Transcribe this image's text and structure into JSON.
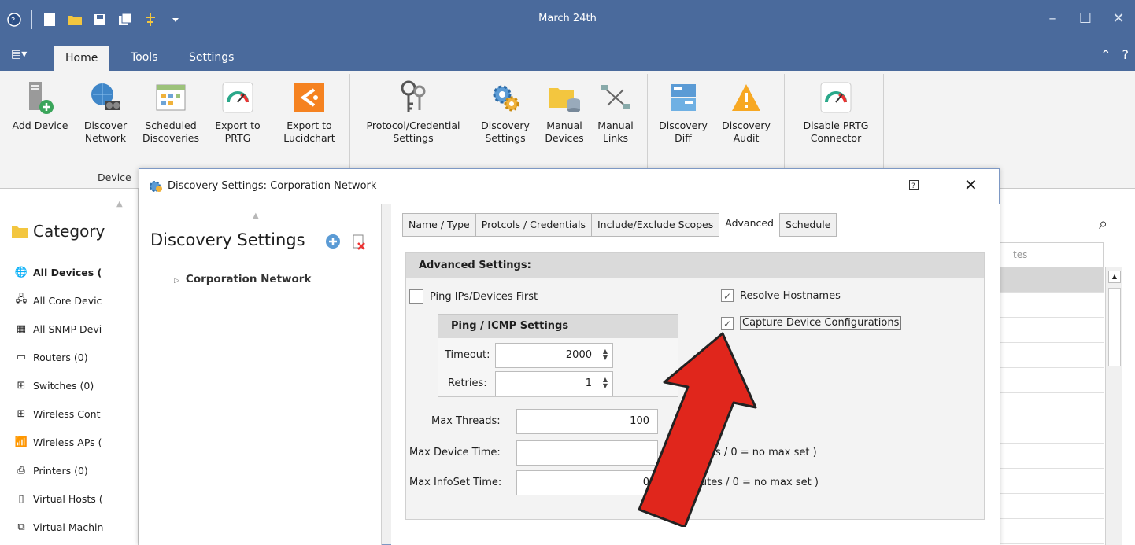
{
  "window": {
    "title": "March 24th"
  },
  "ribbon_tabs": [
    "Home",
    "Tools",
    "Settings"
  ],
  "ribbon_buttons": [
    {
      "name": "add-device",
      "line1": "Add Device",
      "line2": ""
    },
    {
      "name": "discover-network",
      "line1": "Discover",
      "line2": "Network"
    },
    {
      "name": "scheduled-discoveries",
      "line1": "Scheduled",
      "line2": "Discoveries"
    },
    {
      "name": "export-prtg",
      "line1": "Export to",
      "line2": "PRTG"
    },
    {
      "name": "export-lucidchart",
      "line1": "Export to",
      "line2": "Lucidchart"
    },
    {
      "name": "protocol-credential-settings",
      "line1": "Protocol/Credential",
      "line2": "Settings"
    },
    {
      "name": "discovery-settings",
      "line1": "Discovery",
      "line2": "Settings"
    },
    {
      "name": "manual-devices",
      "line1": "Manual",
      "line2": "Devices"
    },
    {
      "name": "manual-links",
      "line1": "Manual",
      "line2": "Links"
    },
    {
      "name": "discovery-diff",
      "line1": "Discovery",
      "line2": "Diff"
    },
    {
      "name": "discovery-audit",
      "line1": "Discovery",
      "line2": "Audit"
    },
    {
      "name": "disable-prtg-connector",
      "line1": "Disable PRTG",
      "line2": "Connector"
    }
  ],
  "ribbon_group_label": "Device",
  "category": {
    "header": "Category",
    "items": [
      "All Devices (",
      "All Core Devic",
      "All SNMP Devi",
      "Routers (0)",
      "Switches (0)",
      "Wireless Cont",
      "Wireless APs (",
      "Printers (0)",
      "Virtual Hosts (",
      "Virtual Machin"
    ]
  },
  "right_grid": {
    "header_fragment": "tes"
  },
  "dialog": {
    "title": "Discovery Settings: Corporation Network",
    "left": {
      "title": "Discovery Settings",
      "node": "Corporation Network"
    },
    "tabs": [
      "Name / Type",
      "Protcols / Credentials",
      "Include/Exclude Scopes",
      "Advanced",
      "Schedule"
    ],
    "active_tab": "Advanced",
    "advanced": {
      "header": "Advanced Settings:",
      "ping_first": {
        "label": "Ping IPs/Devices First",
        "checked": false
      },
      "resolve_hostnames": {
        "label": "Resolve Hostnames",
        "checked": true
      },
      "capture_configs": {
        "label": "Capture Device Configurations",
        "checked": true
      },
      "icmp": {
        "header": "Ping / ICMP Settings",
        "timeout_label": "Timeout:",
        "timeout_value": "2000",
        "retries_label": "Retries:",
        "retries_value": "1"
      },
      "max_threads_label": "Max Threads:",
      "max_threads_value": "100",
      "max_device_time_label": "Max Device Time:",
      "max_device_time_note": "iutes / 0 = no max set )",
      "max_infoset_time_label": "Max InfoSet Time:",
      "max_infoset_time_value": "0",
      "max_infoset_time_note": "inutes / 0 = no max set )"
    }
  },
  "colors": {
    "titlebar": "#4a6a9c",
    "arrow": "#e0261c"
  }
}
